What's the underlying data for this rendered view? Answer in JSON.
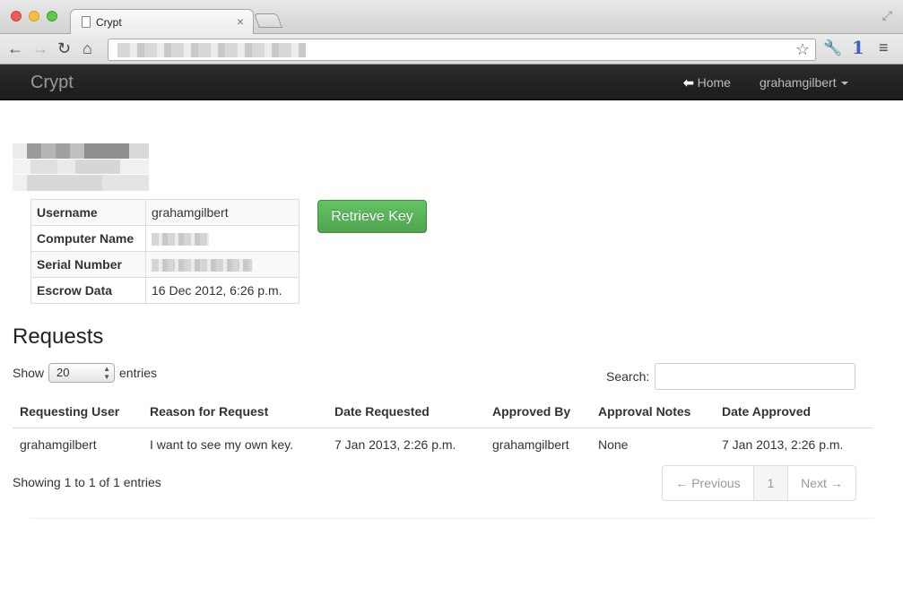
{
  "browser": {
    "tab_title": "Crypt",
    "tab_close": "×",
    "nav_icons": {
      "back": "←",
      "forward": "→",
      "reload": "↻",
      "home": "⌂",
      "star": "☆",
      "wrench": "🔧",
      "onepassword": "1",
      "menu": "≡",
      "fullscreen": "⤢"
    }
  },
  "navbar": {
    "brand": "Crypt",
    "home_link": "Home",
    "home_arrow": "🡐",
    "user_menu": "grahamgilbert"
  },
  "computer_info": {
    "rows": [
      {
        "label": "Username",
        "value": "grahamgilbert"
      },
      {
        "label": "Computer Name",
        "value": ""
      },
      {
        "label": "Serial Number",
        "value": ""
      },
      {
        "label": "Escrow Data",
        "value": "16 Dec 2012, 6:26 p.m."
      }
    ]
  },
  "retrieve_button": "Retrieve Key",
  "requests": {
    "title": "Requests",
    "show_label": "Show",
    "length_value": "20",
    "entries_label": "entries",
    "search_label": "Search:",
    "search_value": "",
    "columns": [
      "Requesting User",
      "Reason for Request",
      "Date Requested",
      "Approved By",
      "Approval Notes",
      "Date Approved"
    ],
    "rows": [
      [
        "grahamgilbert",
        "I want to see my own key.",
        "7 Jan 2013, 2:26 p.m.",
        "grahamgilbert",
        "None",
        "7 Jan 2013, 2:26 p.m."
      ]
    ],
    "info": "Showing 1 to 1 of 1 entries",
    "pagination": {
      "previous": "← Previous",
      "page": "1",
      "next": "Next →"
    }
  }
}
